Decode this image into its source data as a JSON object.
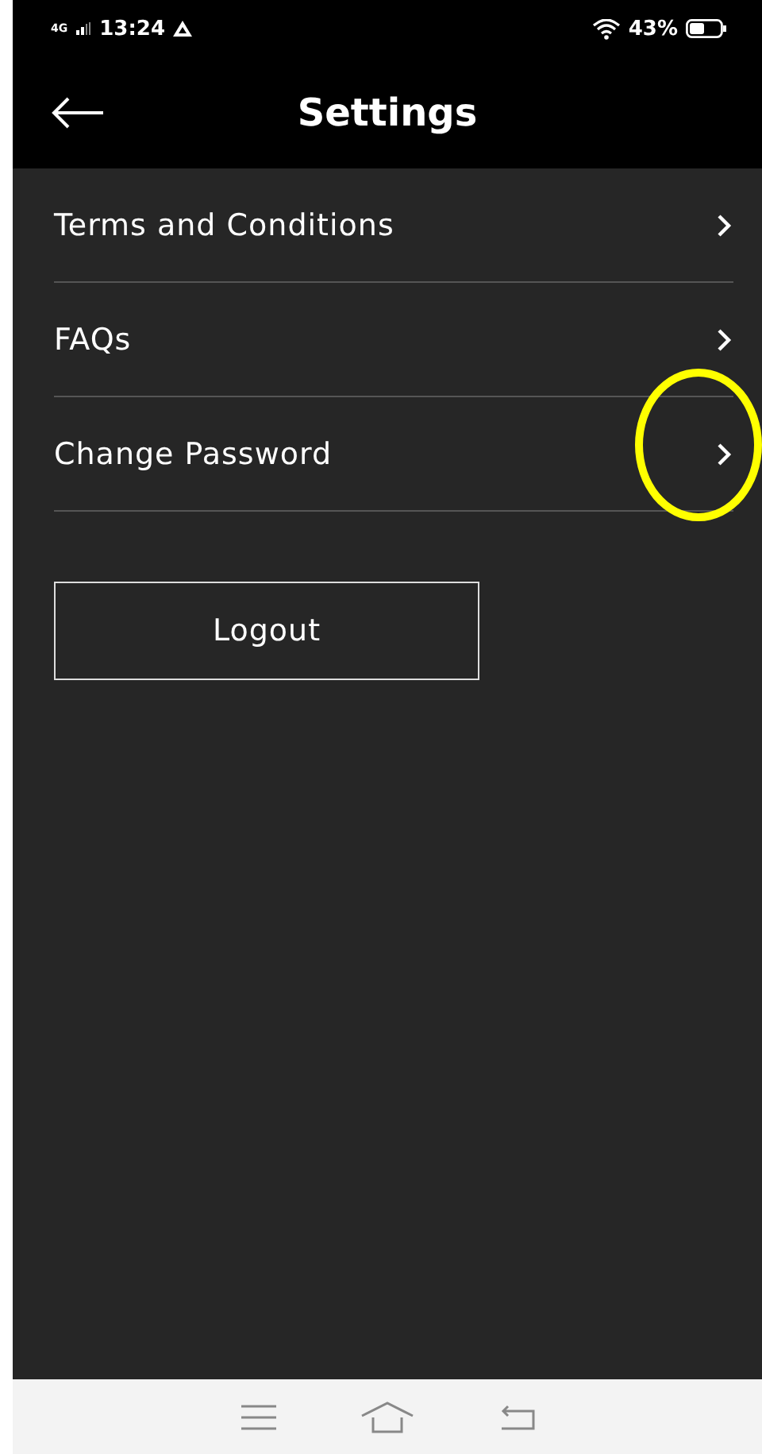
{
  "status_bar": {
    "network": "4G",
    "time": "13:24",
    "battery": "43%"
  },
  "header": {
    "title": "Settings"
  },
  "items": [
    {
      "label": "Terms and Conditions",
      "highlighted": false
    },
    {
      "label": "FAQs",
      "highlighted": false
    },
    {
      "label": "Change Password",
      "highlighted": true
    }
  ],
  "logout_button": "Logout"
}
